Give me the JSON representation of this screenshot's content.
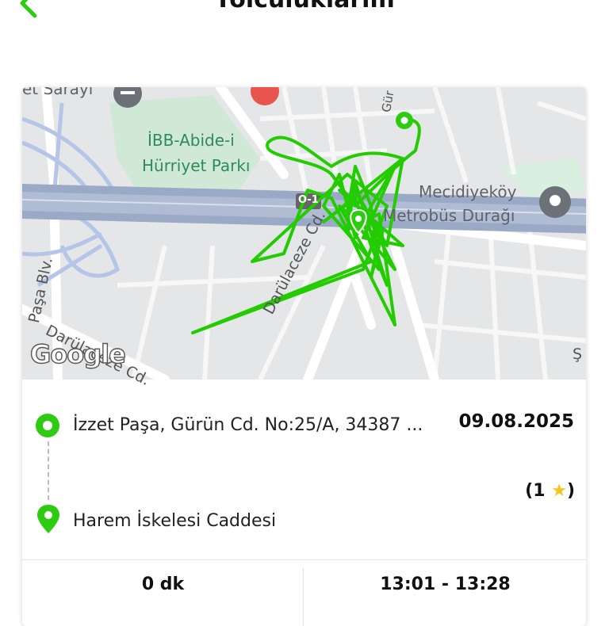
{
  "header": {
    "title": "Yolculuklarım",
    "back_icon": "chevron-left-icon"
  },
  "colors": {
    "accent": "#2ecc11",
    "route": "#22cc00",
    "star": "#f5c518"
  },
  "map": {
    "labels": {
      "palace": "et Sarayı",
      "park_line1": "İBB-Abide-i",
      "park_line2": "Hürriyet Parkı",
      "metro_line1": "Mecidiyeköy",
      "metro_line2": "Metrobüs Durağı",
      "highway": "O-1",
      "road_darulaceze_1": "Darülaceze Cd.",
      "road_darulaceze_2": "Darülaceze Cd.",
      "road_pasa": "Paşa Blv.",
      "road_gurun": "Gür",
      "edge_letter": "Ş",
      "attribution": "Google"
    }
  },
  "trip": {
    "origin": "İzzet Paşa, Gürün Cd. No:25/A, 34387 ...",
    "destination": "Harem İskelesi Caddesi",
    "date": "09.08.2025",
    "rating_open": "(1 ",
    "rating_star": "★",
    "rating_close": ")"
  },
  "stats": {
    "duration": "0 dk",
    "time_range": "13:01 - 13:28"
  }
}
